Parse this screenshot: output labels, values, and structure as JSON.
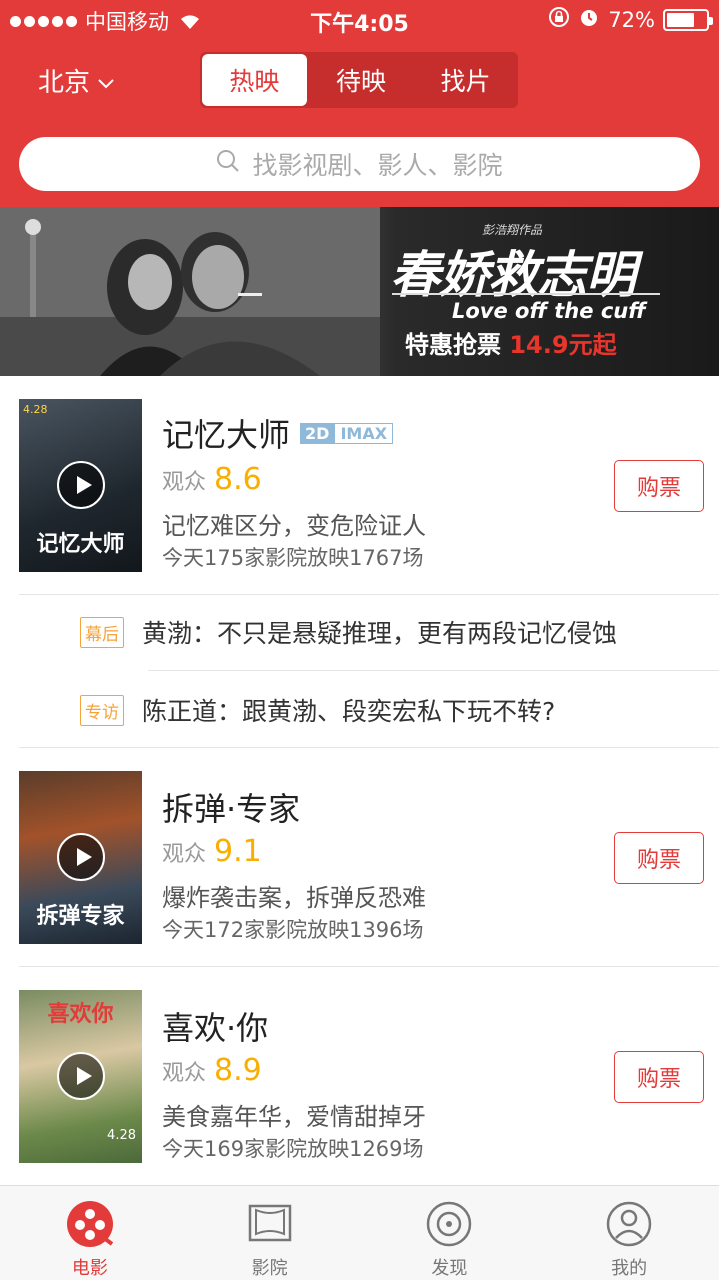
{
  "statusbar": {
    "carrier": "中国移动",
    "time": "下午4:05",
    "battery": "72%",
    "battery_level": 0.72
  },
  "header": {
    "city": "北京",
    "tabs": [
      {
        "label": "热映",
        "active": true
      },
      {
        "label": "待映",
        "active": false
      },
      {
        "label": "找片",
        "active": false
      }
    ],
    "search_placeholder": "找影视剧、影人、影院"
  },
  "banner": {
    "subtitle": "彭浩翔作品",
    "title": "春娇救志明",
    "title_en": "Love off the cuff",
    "promo": "特惠抢票",
    "price": "14.9元起"
  },
  "movies": [
    {
      "title": "记忆大师",
      "tags": [
        "2D",
        "IMAX"
      ],
      "score_label": "观众",
      "score": "8.6",
      "desc": "记忆难区分，变危险证人",
      "showings": "今天175家影院放映1767场",
      "buy": "购票",
      "poster_text": "记忆大师",
      "poster_date": "4.28"
    },
    {
      "title": "拆弹·专家",
      "score_label": "观众",
      "score": "9.1",
      "desc": "爆炸袭击案，拆弹反恐难",
      "showings": "今天172家影院放映1396场",
      "buy": "购票",
      "poster_text": "拆弹专家"
    },
    {
      "title": "喜欢·你",
      "score_label": "观众",
      "score": "8.9",
      "desc": "美食嘉年华，爱情甜掉牙",
      "showings": "今天169家影院放映1269场",
      "buy": "购票",
      "poster_text": "喜欢你",
      "poster_date": "4.28"
    }
  ],
  "news": [
    {
      "tag": "幕后",
      "text": "黄渤：不只是悬疑推理，更有两段记忆侵蚀"
    },
    {
      "tag": "专访",
      "text": "陈正道：跟黄渤、段奕宏私下玩不转?"
    }
  ],
  "tabbar": [
    {
      "label": "电影",
      "icon": "film-reel-icon",
      "active": true
    },
    {
      "label": "影院",
      "icon": "cinema-screen-icon",
      "active": false
    },
    {
      "label": "发现",
      "icon": "discover-icon",
      "active": false
    },
    {
      "label": "我的",
      "icon": "user-icon",
      "active": false
    }
  ],
  "colors": {
    "brand": "#e33b3a",
    "score": "#faaf00",
    "news_tag": "#f5a33b",
    "imax_tag": "#8fb9d9"
  }
}
